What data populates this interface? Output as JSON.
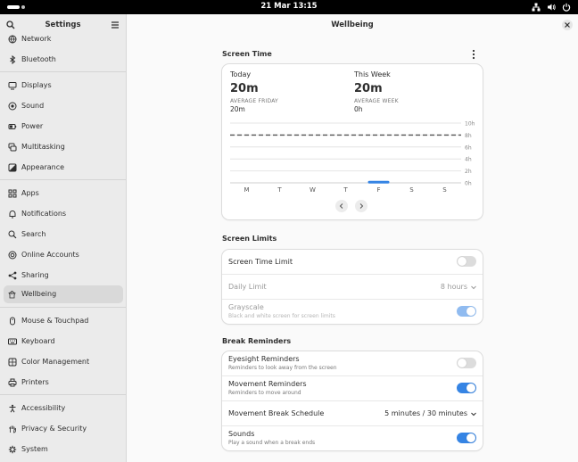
{
  "topbar": {
    "clock": "21 Mar  13:15"
  },
  "sidebar": {
    "title": "Settings",
    "items": [
      {
        "label": "Network",
        "icon": "network-icon"
      },
      {
        "label": "Bluetooth",
        "icon": "bluetooth-icon"
      },
      {
        "label": "Displays",
        "icon": "display-icon"
      },
      {
        "label": "Sound",
        "icon": "speaker-icon"
      },
      {
        "label": "Power",
        "icon": "power-icon"
      },
      {
        "label": "Multitasking",
        "icon": "multitasking-icon"
      },
      {
        "label": "Appearance",
        "icon": "appearance-icon"
      },
      {
        "label": "Apps",
        "icon": "apps-grid-icon"
      },
      {
        "label": "Notifications",
        "icon": "bell-icon"
      },
      {
        "label": "Search",
        "icon": "search-icon"
      },
      {
        "label": "Online Accounts",
        "icon": "at-icon"
      },
      {
        "label": "Sharing",
        "icon": "share-icon"
      },
      {
        "label": "Wellbeing",
        "icon": "wellbeing-icon"
      },
      {
        "label": "Mouse & Touchpad",
        "icon": "mouse-icon"
      },
      {
        "label": "Keyboard",
        "icon": "keyboard-icon"
      },
      {
        "label": "Color Management",
        "icon": "color-icon"
      },
      {
        "label": "Printers",
        "icon": "printer-icon"
      },
      {
        "label": "Accessibility",
        "icon": "accessibility-icon"
      },
      {
        "label": "Privacy & Security",
        "icon": "hand-icon"
      },
      {
        "label": "System",
        "icon": "gear-icon"
      }
    ],
    "active": "Wellbeing"
  },
  "main": {
    "title": "Wellbeing",
    "screen_time": {
      "section_title": "Screen Time",
      "today": {
        "label": "Today",
        "value": "20m",
        "avg_label": "AVERAGE FRIDAY",
        "avg_value": "20m"
      },
      "week": {
        "label": "This Week",
        "value": "20m",
        "avg_label": "AVERAGE WEEK",
        "avg_value": "0h"
      }
    },
    "screen_limits": {
      "section_title": "Screen Limits",
      "screen_time_limit": {
        "label": "Screen Time Limit",
        "on": false
      },
      "daily_limit": {
        "label": "Daily Limit",
        "value": "8 hours"
      },
      "grayscale": {
        "label": "Grayscale",
        "subtitle": "Black and white screen for screen limits",
        "on": true
      }
    },
    "break_reminders": {
      "section_title": "Break Reminders",
      "eyesight": {
        "label": "Eyesight Reminders",
        "subtitle": "Reminders to look away from the screen",
        "on": false
      },
      "movement": {
        "label": "Movement Reminders",
        "subtitle": "Reminders to move around",
        "on": true
      },
      "schedule": {
        "label": "Movement Break Schedule",
        "value": "5 minutes / 30 minutes"
      },
      "sounds": {
        "label": "Sounds",
        "subtitle": "Play a sound when a break ends",
        "on": true
      }
    }
  },
  "colors": {
    "accent": "#3584e4",
    "sidebar_bg": "#ebebeb",
    "selected": "#d9d9d9"
  },
  "chart_data": {
    "type": "bar",
    "categories": [
      "M",
      "T",
      "W",
      "T",
      "F",
      "S",
      "S"
    ],
    "values_minutes": [
      0,
      0,
      0,
      0,
      20,
      0,
      0
    ],
    "y_tick_labels": [
      "0h",
      "2h",
      "4h",
      "6h",
      "8h",
      "10h"
    ],
    "ylim_hours": [
      0,
      10
    ],
    "limit_line_hours": 8,
    "grid": true
  }
}
